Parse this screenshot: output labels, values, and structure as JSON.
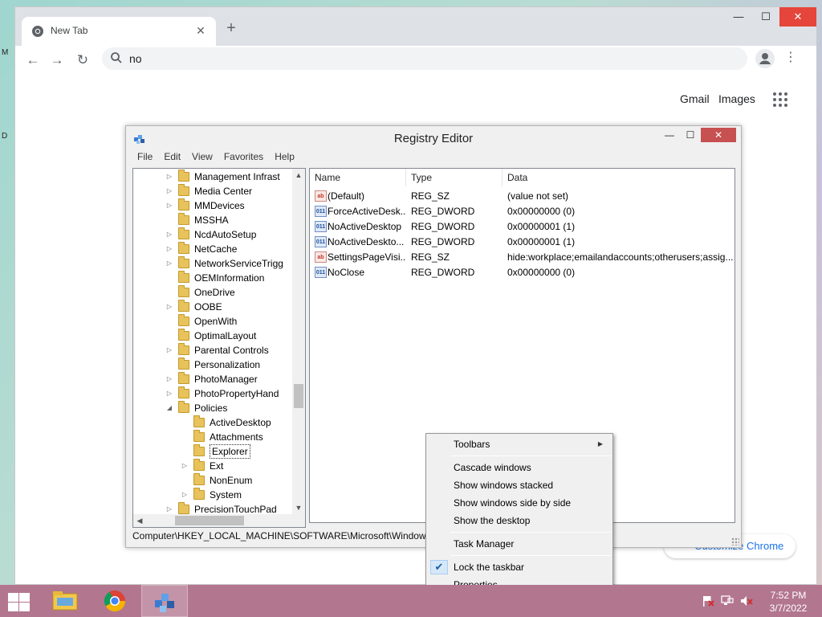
{
  "desktop": {
    "edge_glyphs": [
      "M",
      "D"
    ]
  },
  "chrome": {
    "tab_title": "New Tab",
    "tab_close": "✕",
    "new_tab": "+",
    "omnibox_value": "no",
    "window_buttons": {
      "minimize": "—",
      "maximize": "☐",
      "close": "✕"
    },
    "nav": {
      "back": "←",
      "forward": "→",
      "reload": "↻"
    },
    "menu_dots": "⋮",
    "links": {
      "gmail": "Gmail",
      "images": "Images"
    },
    "customize_label": "Customize Chrome"
  },
  "regedit": {
    "title": "Registry Editor",
    "window_buttons": {
      "minimize": "—",
      "maximize": "☐",
      "close": "✕"
    },
    "menu": [
      "File",
      "Edit",
      "View",
      "Favorites",
      "Help"
    ],
    "tree": [
      {
        "label": "Management Infrast",
        "depth": 0,
        "expander": "▷"
      },
      {
        "label": "Media Center",
        "depth": 0,
        "expander": "▷"
      },
      {
        "label": "MMDevices",
        "depth": 0,
        "expander": "▷"
      },
      {
        "label": "MSSHA",
        "depth": 0,
        "expander": ""
      },
      {
        "label": "NcdAutoSetup",
        "depth": 0,
        "expander": "▷"
      },
      {
        "label": "NetCache",
        "depth": 0,
        "expander": "▷"
      },
      {
        "label": "NetworkServiceTrigg",
        "depth": 0,
        "expander": "▷"
      },
      {
        "label": "OEMInformation",
        "depth": 0,
        "expander": ""
      },
      {
        "label": "OneDrive",
        "depth": 0,
        "expander": ""
      },
      {
        "label": "OOBE",
        "depth": 0,
        "expander": "▷"
      },
      {
        "label": "OpenWith",
        "depth": 0,
        "expander": ""
      },
      {
        "label": "OptimalLayout",
        "depth": 0,
        "expander": ""
      },
      {
        "label": "Parental Controls",
        "depth": 0,
        "expander": "▷"
      },
      {
        "label": "Personalization",
        "depth": 0,
        "expander": ""
      },
      {
        "label": "PhotoManager",
        "depth": 0,
        "expander": "▷"
      },
      {
        "label": "PhotoPropertyHand",
        "depth": 0,
        "expander": "▷"
      },
      {
        "label": "Policies",
        "depth": 0,
        "expander": "◢"
      },
      {
        "label": "ActiveDesktop",
        "depth": 1,
        "expander": ""
      },
      {
        "label": "Attachments",
        "depth": 1,
        "expander": ""
      },
      {
        "label": "Explorer",
        "depth": 1,
        "expander": "",
        "selected": true
      },
      {
        "label": "Ext",
        "depth": 1,
        "expander": "▷"
      },
      {
        "label": "NonEnum",
        "depth": 1,
        "expander": ""
      },
      {
        "label": "System",
        "depth": 1,
        "expander": "▷"
      },
      {
        "label": "PrecisionTouchPad",
        "depth": 0,
        "expander": "▷"
      }
    ],
    "scroll_arrows": {
      "up": "▲",
      "down": "▼",
      "left": "◀",
      "right": "▶"
    },
    "columns": [
      "Name",
      "Type",
      "Data"
    ],
    "values": [
      {
        "icon": "sz",
        "icon_text": "ab",
        "name": "(Default)",
        "type": "REG_SZ",
        "data": "(value not set)"
      },
      {
        "icon": "dw",
        "icon_text": "011",
        "name": "ForceActiveDesk...",
        "type": "REG_DWORD",
        "data": "0x00000000 (0)"
      },
      {
        "icon": "dw",
        "icon_text": "011",
        "name": "NoActiveDesktop",
        "type": "REG_DWORD",
        "data": "0x00000001 (1)"
      },
      {
        "icon": "dw",
        "icon_text": "011",
        "name": "NoActiveDeskto...",
        "type": "REG_DWORD",
        "data": "0x00000001 (1)"
      },
      {
        "icon": "sz",
        "icon_text": "ab",
        "name": "SettingsPageVisi...",
        "type": "REG_SZ",
        "data": "hide:workplace;emailandaccounts;otherusers;assig..."
      },
      {
        "icon": "dw",
        "icon_text": "011",
        "name": "NoClose",
        "type": "REG_DWORD",
        "data": "0x00000000 (0)"
      }
    ],
    "status_path": "Computer\\HKEY_LOCAL_MACHINE\\SOFTWARE\\Microsoft\\Windows"
  },
  "context_menu": {
    "items": [
      {
        "label": "Toolbars",
        "submenu": true,
        "submenu_glyph": "▶"
      },
      {
        "separator": true
      },
      {
        "label": "Cascade windows"
      },
      {
        "label": "Show windows stacked"
      },
      {
        "label": "Show windows side by side"
      },
      {
        "label": "Show the desktop"
      },
      {
        "separator": true
      },
      {
        "label": "Task Manager"
      },
      {
        "separator": true
      },
      {
        "label": "Lock the taskbar",
        "checked": true,
        "check_glyph": "✔"
      },
      {
        "label": "Properties"
      }
    ]
  },
  "taskbar": {
    "apps": [
      "file-explorer-icon",
      "chrome-icon",
      "registry-editor-icon"
    ],
    "active_app": "registry-editor-icon",
    "tray": [
      "action-center-flag-icon",
      "network-icon",
      "volume-muted-icon"
    ],
    "time": "7:52 PM",
    "date": "3/7/2022"
  },
  "colors": {
    "taskbar": "#b3768f",
    "chrome_tab_strip": "#dee1e6",
    "close_red": "#c75050",
    "link_blue": "#1a73e8"
  }
}
